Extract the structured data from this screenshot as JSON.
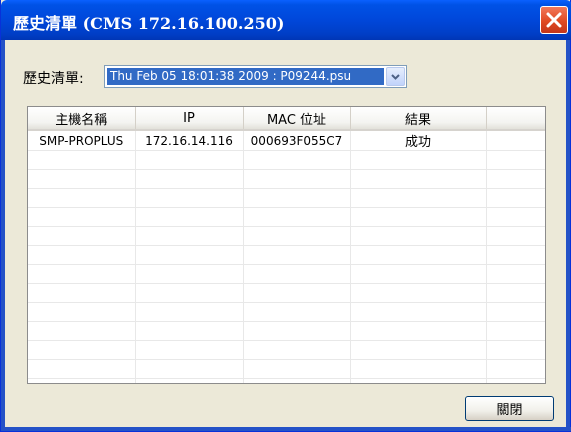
{
  "window": {
    "title": "歷史清單 (CMS  172.16.100.250)"
  },
  "history": {
    "label": "歷史清單:",
    "selected": "Thu Feb 05 18:01:38 2009 : P09244.psu"
  },
  "table": {
    "columns": [
      "主機名稱",
      "IP",
      "MAC 位址",
      "結果",
      ""
    ],
    "rows": [
      [
        "SMP-PROPLUS",
        "172.16.14.116",
        "000693F055C7",
        "成功",
        ""
      ]
    ],
    "empty_row_count": 13
  },
  "buttons": {
    "close_label": "關閉"
  },
  "icons": {
    "close": "close-icon",
    "dropdown": "chevron-down-icon"
  },
  "colors": {
    "titlebar": "#0047da",
    "close_button": "#e04a23",
    "selection": "#316ac5",
    "dialog_bg": "#ece9d8"
  }
}
